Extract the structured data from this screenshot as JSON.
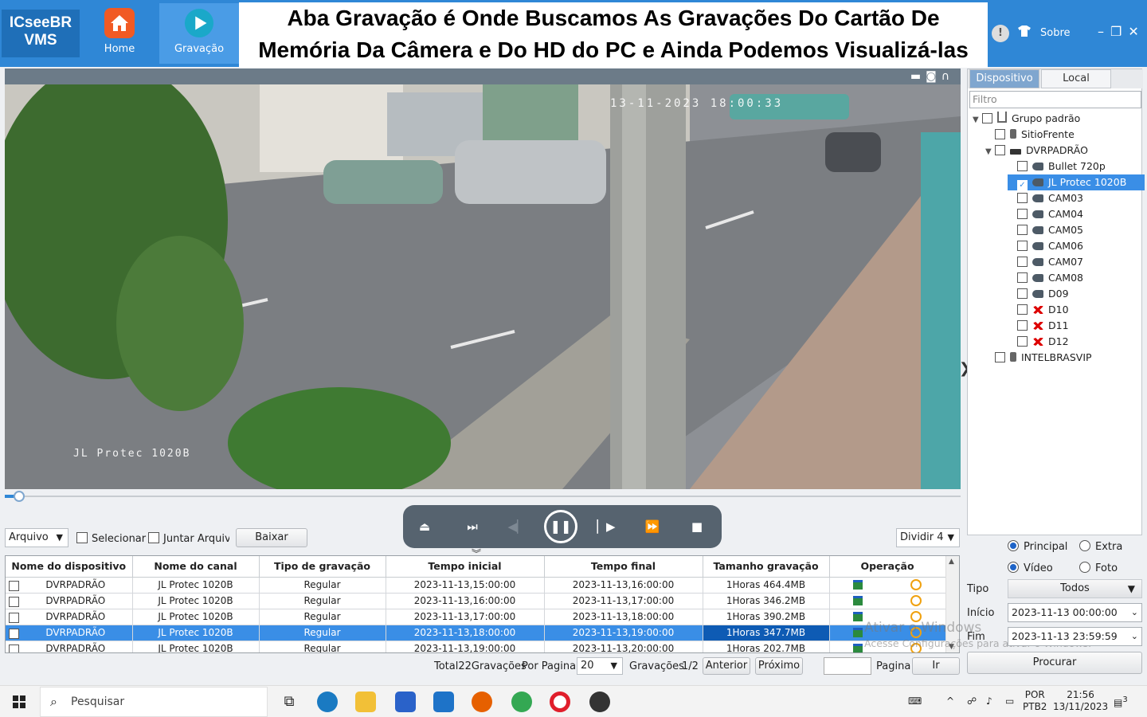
{
  "app": {
    "logo_line1": "ICseeBR",
    "logo_line2": "VMS",
    "nav": [
      {
        "label": "Home",
        "icon": "home-icon"
      },
      {
        "label": "Gravação",
        "icon": "play-icon"
      }
    ],
    "banner_line1": "Aba Gravação é Onde Buscamos As Gravações Do Cartão De",
    "banner_line2": "Memória Da Câmera e Do HD do PC e Ainda Podemos Visualizá-las",
    "about_label": "Sobre",
    "info_glyph": "!",
    "accent": "#2f87d6"
  },
  "video": {
    "osd_time": "13-11-2023 18:00:33",
    "osd_channel": "JL Protec 1020B",
    "progress_fraction": 0.015
  },
  "toolbar": {
    "source_select": "Arquivo",
    "select_label": "Selecionar",
    "merge_label": "Juntar Arquivo",
    "download_label": "Baixar",
    "split_select": "Dividir 4"
  },
  "table": {
    "headers": [
      "Nome do dispositivo",
      "Nome do canal",
      "Tipo de gravação",
      "Tempo inicial",
      "Tempo final",
      "Tamanho gravação",
      "Operação"
    ],
    "rows": [
      {
        "device": "DVRPADRÃO",
        "channel": "JL Protec 1020B",
        "type": "Regular",
        "start": "2023-11-13,15:00:00",
        "end": "2023-11-13,16:00:00",
        "size": "1Horas 464.4MB"
      },
      {
        "device": "DVRPADRÃO",
        "channel": "JL Protec 1020B",
        "type": "Regular",
        "start": "2023-11-13,16:00:00",
        "end": "2023-11-13,17:00:00",
        "size": "1Horas 346.2MB"
      },
      {
        "device": "DVRPADRÃO",
        "channel": "JL Protec 1020B",
        "type": "Regular",
        "start": "2023-11-13,17:00:00",
        "end": "2023-11-13,18:00:00",
        "size": "1Horas 390.2MB"
      },
      {
        "device": "DVRPADRÃO",
        "channel": "JL Protec 1020B",
        "type": "Regular",
        "start": "2023-11-13,18:00:00",
        "end": "2023-11-13,19:00:00",
        "size": "1Horas 347.7MB",
        "selected": true
      },
      {
        "device": "DVRPADRÃO",
        "channel": "JL Protec 1020B",
        "type": "Regular",
        "start": "2023-11-13,19:00:00",
        "end": "2023-11-13,20:00:00",
        "size": "1Horas 202.7MB"
      }
    ]
  },
  "pager": {
    "total": "Total22Gravações",
    "per_page_label": "Por Pagina",
    "per_page_value": "20",
    "records_label": "Gravações",
    "page_indicator": "1/2",
    "prev_label": "Anterior",
    "next_label": "Próximo",
    "page_label": "Pagina",
    "go_label": "Ir"
  },
  "sidebar": {
    "tab_device": "Dispositivo",
    "tab_local": "Local",
    "filter_placeholder": "Filtro",
    "tree": [
      {
        "label": "Grupo padrão",
        "level": 0,
        "icon": "group-icon",
        "expander": "▼"
      },
      {
        "label": "SitioFrente",
        "level": 1,
        "icon": "ipcam-icon"
      },
      {
        "label": "DVRPADRÃO",
        "level": 1,
        "icon": "dvr-icon",
        "expander": "▼"
      },
      {
        "label": "Bullet 720p",
        "level": 2,
        "icon": "camera-icon"
      },
      {
        "label": "JL Protec 1020B",
        "level": 2,
        "icon": "camera-icon",
        "checked": true
      },
      {
        "label": "CAM03",
        "level": 2,
        "icon": "camera-icon"
      },
      {
        "label": "CAM04",
        "level": 2,
        "icon": "camera-icon"
      },
      {
        "label": "CAM05",
        "level": 2,
        "icon": "camera-icon"
      },
      {
        "label": "CAM06",
        "level": 2,
        "icon": "camera-icon"
      },
      {
        "label": "CAM07",
        "level": 2,
        "icon": "camera-icon"
      },
      {
        "label": "CAM08",
        "level": 2,
        "icon": "camera-icon"
      },
      {
        "label": "D09",
        "level": 2,
        "icon": "camera-icon"
      },
      {
        "label": "D10",
        "level": 2,
        "icon": "camera-offline-icon"
      },
      {
        "label": "D11",
        "level": 2,
        "icon": "camera-offline-icon"
      },
      {
        "label": "D12",
        "level": 2,
        "icon": "camera-offline-icon"
      },
      {
        "label": "INTELBRASVIP",
        "level": 1,
        "icon": "ipcam-icon"
      }
    ]
  },
  "search": {
    "stream_main": "Principal",
    "stream_extra": "Extra",
    "media_video": "Vídeo",
    "media_photo": "Foto",
    "type_label": "Tipo",
    "type_value": "Todos",
    "start_label": "Início",
    "start_value": "2023-11-13 00:00:00",
    "end_label": "Fim",
    "end_value": "2023-11-13 23:59:59",
    "search_button": "Procurar"
  },
  "watermark": {
    "line1": "Ativar o Windows",
    "line2": "Acesse Configurações para ativar o Windows."
  },
  "taskbar": {
    "search_placeholder": "Pesquisar",
    "lang": "POR",
    "layout": "PTB2",
    "time": "21:56",
    "date": "13/11/2023",
    "notifications": "3"
  }
}
